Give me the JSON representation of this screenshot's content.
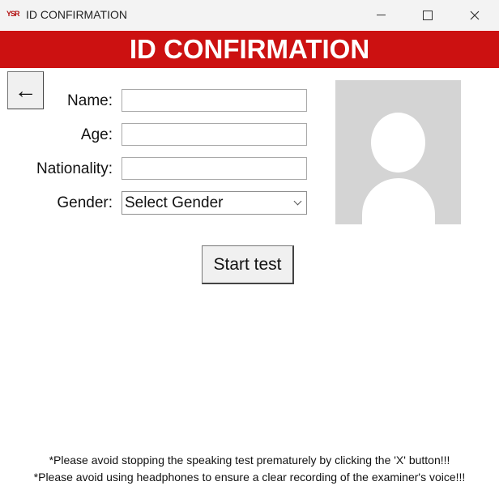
{
  "window": {
    "icon_text": "YSR",
    "title": "ID CONFIRMATION",
    "minimize_glyph": "—",
    "maximize_glyph": "☐",
    "close_glyph": "✕"
  },
  "banner": {
    "title": "ID CONFIRMATION"
  },
  "back_button": {
    "glyph": "←"
  },
  "form": {
    "name_label": "Name:",
    "name_value": "",
    "age_label": "Age:",
    "age_value": "",
    "nationality_label": "Nationality:",
    "nationality_value": "",
    "gender_label": "Gender:",
    "gender_selected": "Select Gender"
  },
  "start_button": {
    "label": "Start test"
  },
  "notices": [
    "*Please avoid stopping the speaking test prematurely by clicking the 'X' button!!!",
    "*Please avoid using headphones to ensure a clear recording of the examiner's voice!!!"
  ],
  "colors": {
    "banner_bg": "#cc1111",
    "photo_placeholder": "#d4d4d4"
  },
  "icons": [
    "app-logo-icon",
    "minimize-icon",
    "maximize-icon",
    "close-icon",
    "back-arrow-icon",
    "chevron-down-icon",
    "avatar-placeholder-icon"
  ]
}
